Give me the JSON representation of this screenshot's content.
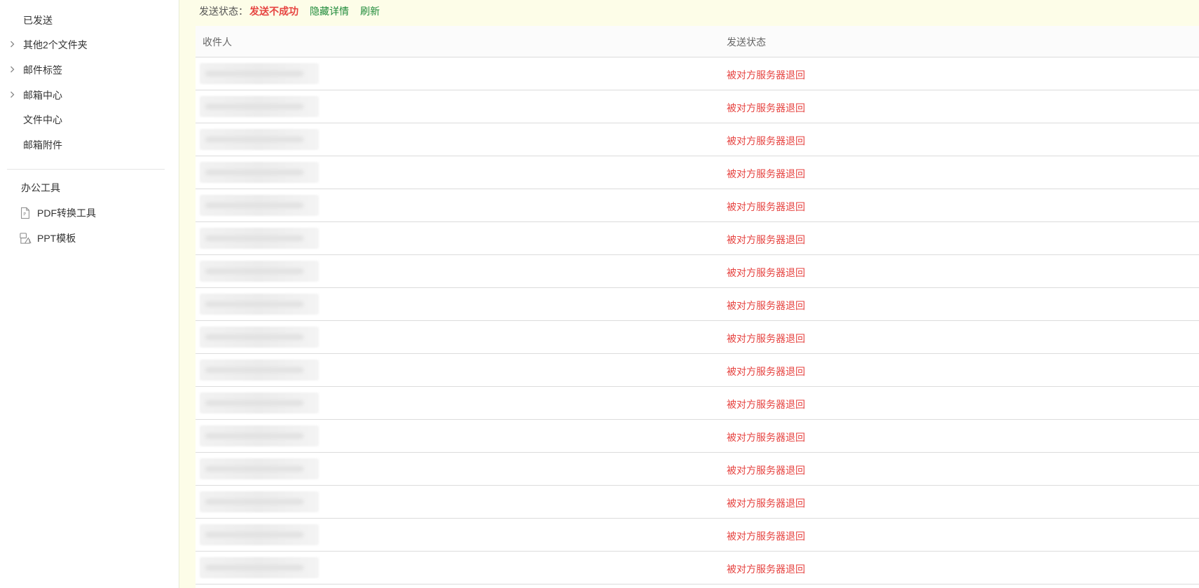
{
  "sidebar": {
    "items": [
      {
        "label": "已发送",
        "expandable": false
      },
      {
        "label": "其他2个文件夹",
        "expandable": true
      },
      {
        "label": "邮件标签",
        "expandable": true
      },
      {
        "label": "邮箱中心",
        "expandable": true
      },
      {
        "label": "文件中心",
        "expandable": false
      },
      {
        "label": "邮箱附件",
        "expandable": false
      }
    ],
    "office_tools_title": "办公工具",
    "tools": [
      {
        "label": "PDF转换工具",
        "icon": "pdf-file-icon"
      },
      {
        "label": "PPT模板",
        "icon": "ppt-template-icon"
      }
    ]
  },
  "status_bar": {
    "label": "发送状态：",
    "value": "发送不成功",
    "hide_details_link": "隐藏详情",
    "refresh_link": "刷新"
  },
  "table": {
    "headers": {
      "recipient": "收件人",
      "status": "发送状态"
    },
    "rows": [
      {
        "status": "被对方服务器退回"
      },
      {
        "status": "被对方服务器退回"
      },
      {
        "status": "被对方服务器退回"
      },
      {
        "status": "被对方服务器退回"
      },
      {
        "status": "被对方服务器退回"
      },
      {
        "status": "被对方服务器退回"
      },
      {
        "status": "被对方服务器退回"
      },
      {
        "status": "被对方服务器退回"
      },
      {
        "status": "被对方服务器退回"
      },
      {
        "status": "被对方服务器退回"
      },
      {
        "status": "被对方服务器退回"
      },
      {
        "status": "被对方服务器退回"
      },
      {
        "status": "被对方服务器退回"
      },
      {
        "status": "被对方服务器退回"
      },
      {
        "status": "被对方服务器退回"
      },
      {
        "status": "被对方服务器退回"
      }
    ]
  },
  "colors": {
    "error_red": "#e64340",
    "link_green": "#1f8a3a",
    "main_background": "#fdfde8"
  }
}
